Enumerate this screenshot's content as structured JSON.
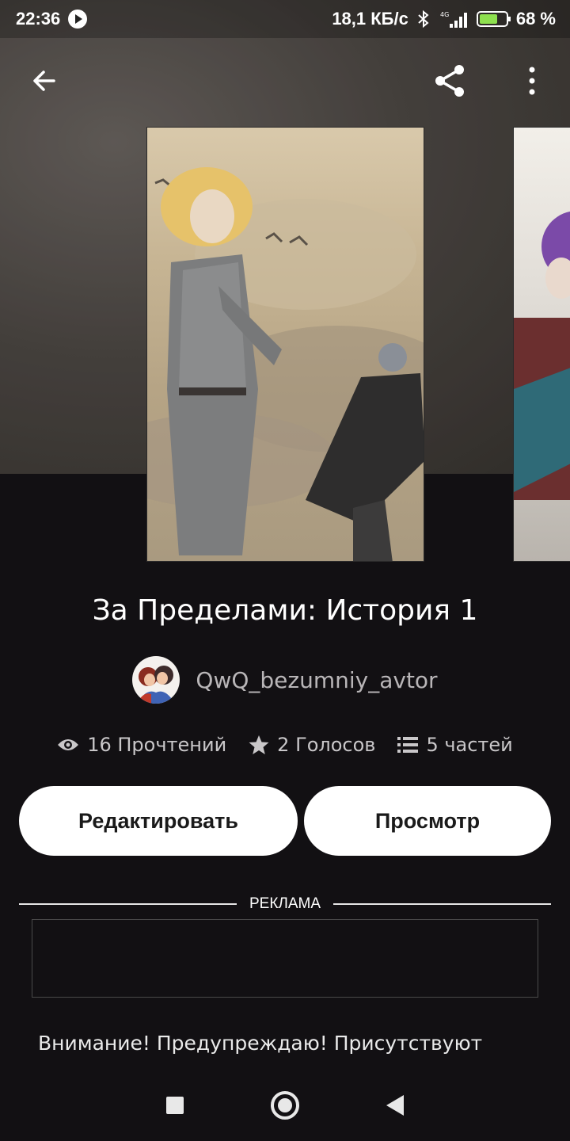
{
  "status_bar": {
    "time": "22:36",
    "network_speed": "18,1 КБ/с",
    "network_type": "4G",
    "battery": "68 %",
    "icons": [
      "play-icon",
      "bluetooth-icon",
      "signal-icon",
      "battery-charging-icon"
    ]
  },
  "toolbar": {
    "icons": [
      "back-arrow-icon",
      "share-icon",
      "more-vertical-icon"
    ]
  },
  "story": {
    "title": "За Пределами: История 1",
    "author": "QwQ_bezumniy_avtor",
    "stats": {
      "reads": "16 Прочтений",
      "votes": "2 Голосов",
      "parts": "5 частей"
    }
  },
  "actions": {
    "edit_label": "Редактировать",
    "view_label": "Просмотр"
  },
  "ad": {
    "label": "РЕКЛАМА"
  },
  "description": {
    "text": "Внимание! Предупреждаю! Присутствуют"
  },
  "colors": {
    "background": "#121013",
    "button_bg": "#ffffff",
    "muted_text": "#b9b6b8"
  }
}
